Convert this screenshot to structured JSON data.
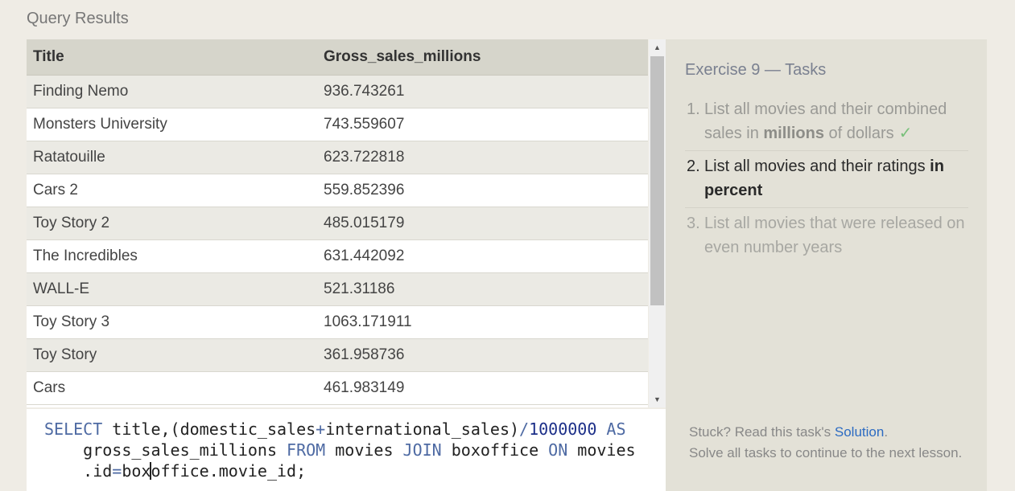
{
  "heading": "Query Results",
  "table": {
    "columns": [
      "Title",
      "Gross_sales_millions"
    ],
    "rows": [
      [
        "Finding Nemo",
        "936.743261"
      ],
      [
        "Monsters University",
        "743.559607"
      ],
      [
        "Ratatouille",
        "623.722818"
      ],
      [
        "Cars 2",
        "559.852396"
      ],
      [
        "Toy Story 2",
        "485.015179"
      ],
      [
        "The Incredibles",
        "631.442092"
      ],
      [
        "WALL-E",
        "521.31186"
      ],
      [
        "Toy Story 3",
        "1063.171911"
      ],
      [
        "Toy Story",
        "361.958736"
      ],
      [
        "Cars",
        "461.983149"
      ]
    ]
  },
  "scrollbar": {
    "up_icon": "triangle-up",
    "down_icon": "triangle-down",
    "up_glyph": "▲",
    "down_glyph": "▼"
  },
  "editor": {
    "line1": {
      "kw_select": "SELECT",
      "t1": " title,(domestic_sales",
      "plus": "+",
      "t2": "international_sales)",
      "slash": "/",
      "number": "1000000",
      "space": " ",
      "kw_as": "AS"
    },
    "line2": {
      "indent": "    gross_sales_millions ",
      "kw_from": "FROM",
      "t1": " movies ",
      "kw_join": "JOIN",
      "t2": " boxoffice ",
      "kw_on": "ON",
      "t3": " movies"
    },
    "line3": {
      "indent": "    .id",
      "eq": "=",
      "before_caret": "box",
      "after_caret": "office.movie_id;"
    }
  },
  "tasks": {
    "title": "Exercise 9 — Tasks",
    "items": [
      {
        "num": "1.",
        "text_a": "List all movies and their combined sales in ",
        "bold": "millions",
        "text_b": " of dollars",
        "check": "✓",
        "status": "done"
      },
      {
        "num": "2.",
        "text_a": "List all movies and their ratings ",
        "bold": "in percent",
        "text_b": "",
        "status": "current"
      },
      {
        "num": "3.",
        "text_a": "List all movies that were released on even number years",
        "status": "todo"
      }
    ],
    "footer": {
      "stuck": "Stuck? Read this task's ",
      "solution_link": "Solution",
      "period": ".",
      "continue": "Solve all tasks to continue to the next lesson."
    }
  },
  "colors": {
    "background": "#efece5",
    "header_row": "#d6d5cb",
    "keyword": "#4e6aa3",
    "number": "#1b2e88",
    "link": "#2c6bc2",
    "check": "#79c07a"
  }
}
